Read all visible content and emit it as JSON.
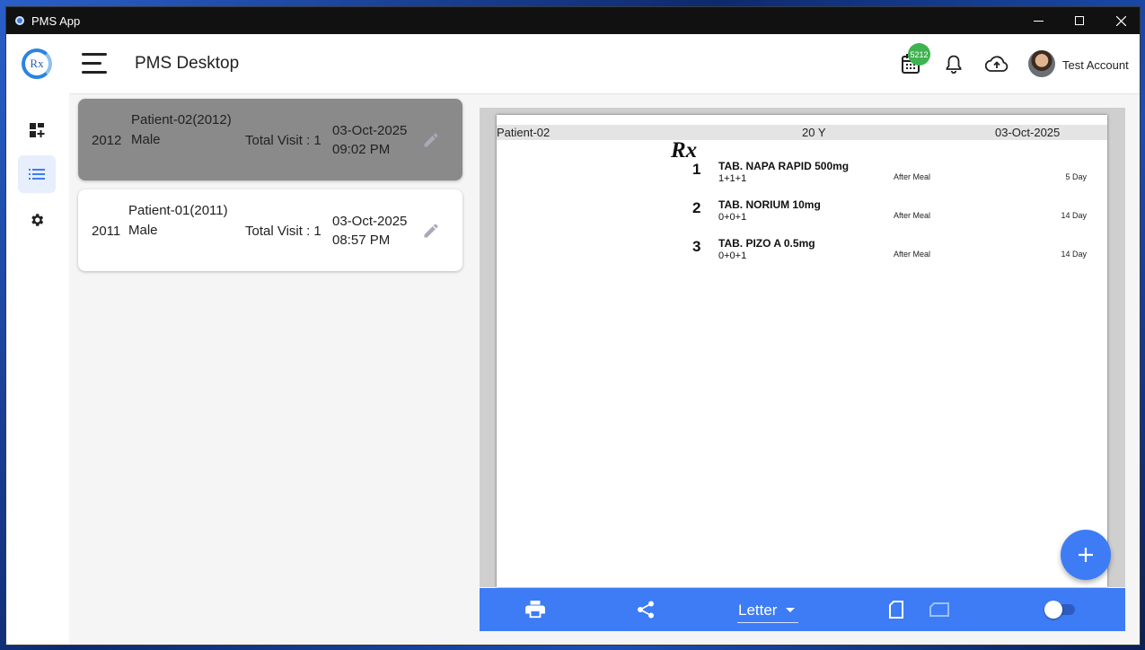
{
  "window": {
    "title": "PMS App",
    "controls": [
      "minimize-icon",
      "maximize-icon",
      "close-icon"
    ]
  },
  "appbar": {
    "title": "PMS Desktop",
    "calendar_badge": "5212",
    "account_name": "Test Account"
  },
  "sidebar": {
    "logo_text": "Rx",
    "items": [
      {
        "name": "dashboard",
        "icon": "dashboard-icon",
        "active": false
      },
      {
        "name": "list",
        "icon": "list-icon",
        "active": true
      },
      {
        "name": "settings",
        "icon": "gear-icon",
        "active": false
      }
    ]
  },
  "patients": [
    {
      "id": "2012",
      "name": "Patient-02(2012)",
      "gender": "Male",
      "visits": "Total Visit : 1",
      "date": "03-Oct-2025",
      "time": "09:02 PM",
      "selected": true
    },
    {
      "id": "2011",
      "name": "Patient-01(2011)",
      "gender": "Male",
      "visits": "Total Visit : 1",
      "date": "03-Oct-2025",
      "time": "08:57 PM",
      "selected": false
    }
  ],
  "prescription": {
    "patient": "Patient-02",
    "age": "20 Y",
    "date": "03-Oct-2025",
    "rx_symbol": "Rx",
    "medicines": [
      {
        "num": "1",
        "name": "TAB. NAPA RAPID 500mg",
        "dose": "1+1+1",
        "when": "After Meal",
        "days": "5 Day"
      },
      {
        "num": "2",
        "name": "TAB. NORIUM 10mg",
        "dose": "0+0+1",
        "when": "After Meal",
        "days": "14 Day"
      },
      {
        "num": "3",
        "name": "TAB. PIZO A 0.5mg",
        "dose": "0+0+1",
        "when": "After Meal",
        "days": "14 Day"
      }
    ]
  },
  "toolbar": {
    "paper_size": "Letter",
    "toggle_on": false,
    "colors": {
      "bar": "#3d7cf5"
    }
  },
  "fab": {
    "icon": "plus-icon"
  }
}
